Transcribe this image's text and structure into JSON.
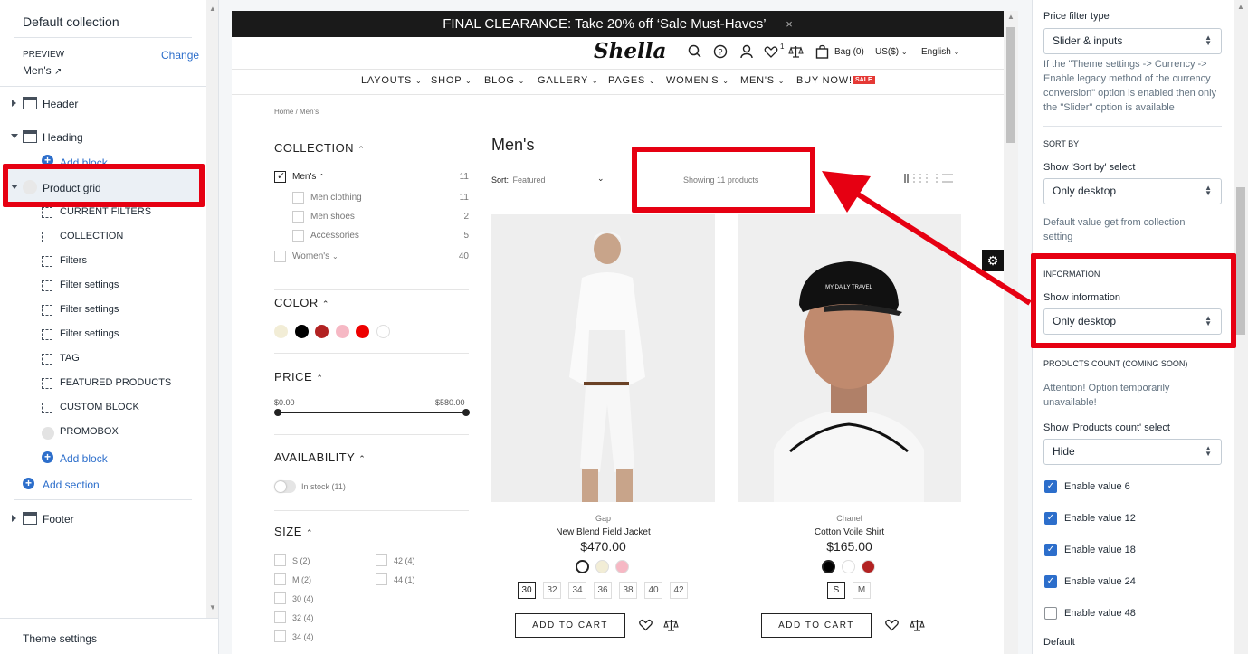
{
  "left_panel": {
    "title": "Default collection",
    "preview_label": "PREVIEW",
    "preview_value": "Men's",
    "change_link": "Change",
    "sections": {
      "header": "Header",
      "heading": "Heading",
      "heading_add_block": "Add block",
      "product_grid": "Product grid",
      "blocks": [
        "CURRENT FILTERS",
        "COLLECTION",
        "Filters",
        "Filter settings",
        "Filter settings",
        "Filter settings",
        "TAG",
        "FEATURED PRODUCTS",
        "CUSTOM BLOCK",
        "PROMOBOX"
      ],
      "grid_add_block": "Add block",
      "add_section": "Add section",
      "footer": "Footer"
    },
    "theme_settings": "Theme settings"
  },
  "preview": {
    "banner": "FINAL CLEARANCE: Take 20% off ‘Sale Must-Haves’",
    "banner_close": "×",
    "logo": "Shella",
    "header": {
      "bag": "Bag (0)",
      "currency": "US($)",
      "language": "English",
      "wishlist_count": "1"
    },
    "nav": [
      "LAYOUTS",
      "SHOP",
      "BLOG",
      "GALLERY",
      "PAGES",
      "WOMEN'S",
      "MEN'S",
      "BUY NOW!"
    ],
    "sale_badge": "SALE",
    "breadcrumb": "Home  /  Men's",
    "collection_title": "COLLECTION",
    "collection_items": [
      {
        "label": "Men's",
        "count": "11"
      },
      {
        "label": "Men clothing",
        "count": "11"
      },
      {
        "label": "Men shoes",
        "count": "2"
      },
      {
        "label": "Accessories",
        "count": "5"
      },
      {
        "label": "Women's",
        "count": "40"
      }
    ],
    "color_title": "COLOR",
    "colors": [
      "#f2edd6",
      "#000000",
      "#b22222",
      "#f6b8c4",
      "#ee0000",
      "#ffffff"
    ],
    "price_title": "PRICE",
    "price_min": "$0.00",
    "price_max": "$580.00",
    "availability_title": "AVAILABILITY",
    "in_stock": "In stock (11)",
    "size_title": "SIZE",
    "sizes_left": [
      "S (2)",
      "M (2)",
      "30 (4)",
      "32 (4)",
      "34 (4)"
    ],
    "sizes_right": [
      "42 (4)",
      "44 (1)"
    ],
    "page_title": "Men's",
    "sort_label": "Sort:",
    "sort_value": "Featured",
    "showing": "Showing 11 products",
    "products": [
      {
        "brand": "Gap",
        "name": "New Blend Field Jacket",
        "price": "$470.00",
        "sizes": [
          "30",
          "32",
          "34",
          "36",
          "38",
          "40",
          "42"
        ],
        "colors": [
          "#ffffff",
          "#f2edd6",
          "#f6b8c4"
        ],
        "cart": "ADD TO CART"
      },
      {
        "brand": "Chanel",
        "name": "Cotton Voile Shirt",
        "price": "$165.00",
        "sizes": [
          "S",
          "M"
        ],
        "colors": [
          "#000000",
          "#ffffff",
          "#b22222"
        ],
        "cart": "ADD TO CART"
      }
    ]
  },
  "right_panel": {
    "price_filter_type_label": "Price filter type",
    "price_filter_type_value": "Slider & inputs",
    "price_filter_hint": "If the \"Theme settings -> Currency -> Enable legacy method of the currency conversion\" option is enabled then only the \"Slider\" option is available",
    "sort_by_heading": "SORT BY",
    "sort_select_label": "Show 'Sort by' select",
    "sort_select_value": "Only desktop",
    "sort_hint": "Default value get from collection setting",
    "information_heading": "INFORMATION",
    "information_label": "Show information",
    "information_value": "Only desktop",
    "products_count_heading": "PRODUCTS COUNT (COMING SOON)",
    "products_count_hint": "Attention! Option temporarily unavailable!",
    "products_count_label": "Show 'Products count' select",
    "products_count_value": "Hide",
    "checkboxes": [
      {
        "label": "Enable value 6",
        "checked": true
      },
      {
        "label": "Enable value 12",
        "checked": true
      },
      {
        "label": "Enable value 18",
        "checked": true
      },
      {
        "label": "Enable value 24",
        "checked": true
      },
      {
        "label": "Enable value 48",
        "checked": false
      }
    ],
    "default_label": "Default"
  },
  "colors": {
    "accent": "#2c6ecb",
    "highlight": "#e60012",
    "sale": "#e53935"
  }
}
